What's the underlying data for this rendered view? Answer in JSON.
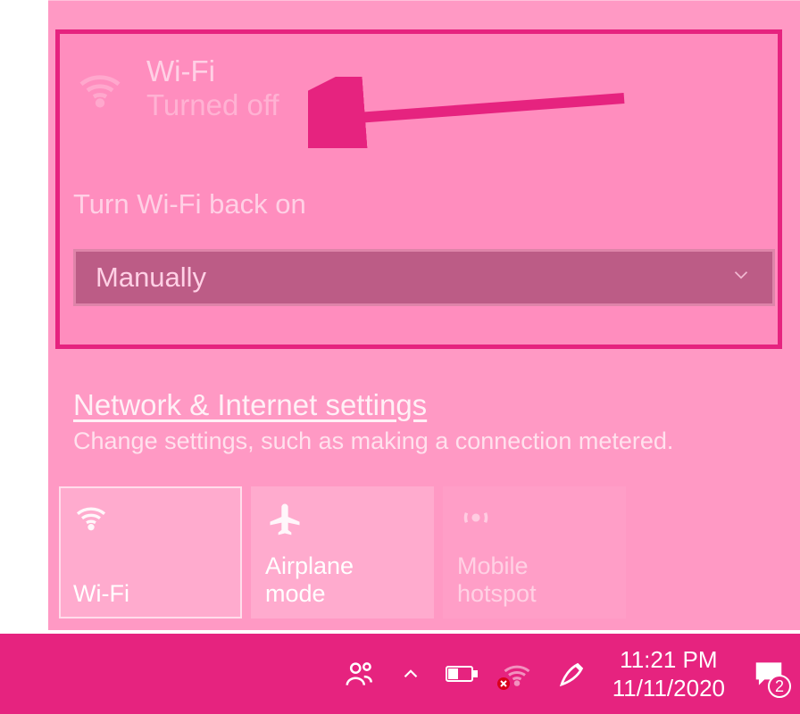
{
  "wifi": {
    "title": "Wi-Fi",
    "status": "Turned off",
    "turn_back_label": "Turn Wi-Fi back on",
    "dropdown_value": "Manually"
  },
  "settings": {
    "link": "Network & Internet settings",
    "description": "Change settings, such as making a connection metered."
  },
  "tiles": [
    {
      "label": "Wi-Fi"
    },
    {
      "label": "Airplane mode"
    },
    {
      "label": "Mobile hotspot"
    }
  ],
  "taskbar": {
    "time": "11:21 PM",
    "date": "11/11/2020",
    "notification_count": "2"
  }
}
